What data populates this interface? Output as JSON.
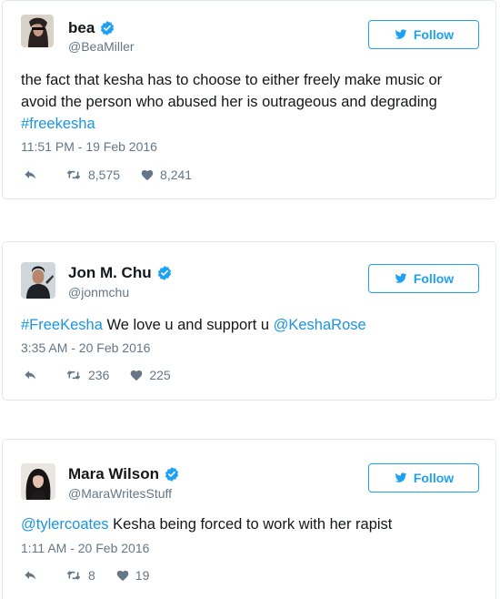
{
  "tweets": [
    {
      "name": "bea",
      "handle": "@BeaMiller",
      "follow_label": "Follow",
      "text_lines": [
        "the fact that kesha has to choose to either freely make music or",
        "avoid the person who abused her is outrageous and degrading"
      ],
      "hashtag": "#freekesha",
      "date": "11:51 PM - 19 Feb 2016",
      "retweets": "8,575",
      "likes": "8,241"
    },
    {
      "name": "Jon M. Chu",
      "handle": "@jonmchu",
      "follow_label": "Follow",
      "hashtag": "#FreeKesha",
      "text_mid": " We love u and support u ",
      "mention": "@KeshaRose",
      "date": "3:35 AM - 20 Feb 2016",
      "retweets": "236",
      "likes": "225"
    },
    {
      "name": "Mara Wilson",
      "handle": "@MaraWritesStuff",
      "follow_label": "Follow",
      "mention": "@tylercoates",
      "text_rest": " Kesha being forced to work with her rapist",
      "date": "1:11 AM - 20 Feb 2016",
      "retweets": "8",
      "likes": "19"
    }
  ],
  "colors": {
    "accent": "#1da1f2",
    "link": "#1b95e0",
    "muted": "#657786"
  }
}
